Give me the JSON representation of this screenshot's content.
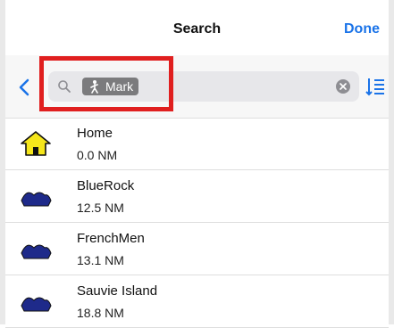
{
  "nav": {
    "title": "Search",
    "done_label": "Done"
  },
  "search": {
    "token_label": "Mark",
    "placeholder": ""
  },
  "icons": {
    "back": "chevron-left-icon",
    "search": "magnifier-icon",
    "token": "mark-person-icon",
    "clear": "clear-x-icon",
    "sort": "sort-list-icon",
    "home": "home-house-icon",
    "waypoint": "mark-boat-icon"
  },
  "colors": {
    "accent": "#1a73e8",
    "highlight": "#e01f1f",
    "home_fill": "#f5e61b",
    "waypoint_fill": "#1e2a8a"
  },
  "results": [
    {
      "name": "Home",
      "distance": "0.0 NM",
      "icon": "home"
    },
    {
      "name": "BlueRock",
      "distance": "12.5 NM",
      "icon": "waypoint"
    },
    {
      "name": "FrenchMen",
      "distance": "13.1 NM",
      "icon": "waypoint"
    },
    {
      "name": "Sauvie Island",
      "distance": "18.8 NM",
      "icon": "waypoint"
    }
  ]
}
